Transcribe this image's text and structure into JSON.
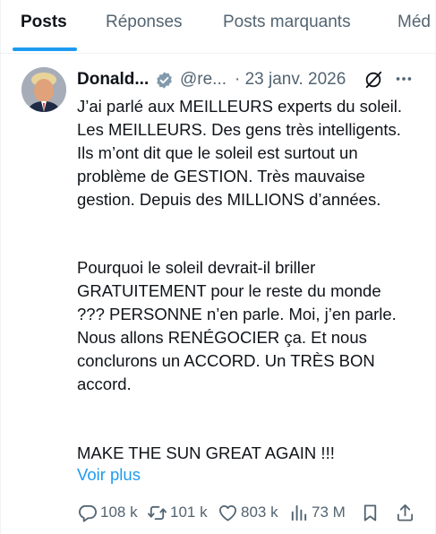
{
  "tabs": [
    {
      "label": "Posts",
      "active": true
    },
    {
      "label": "Réponses",
      "active": false
    },
    {
      "label": "Posts marquants",
      "active": false
    },
    {
      "label": "Méd",
      "active": false
    }
  ],
  "post": {
    "author_name": "Donald...",
    "handle": "@re...",
    "date": "· 23 janv. 2026",
    "paragraphs": [
      [
        "J’ai parlé aux MEILLEURS experts du soleil.",
        "Les MEILLEURS. Des gens très intelligents.",
        "Ils m’ont dit que le soleil est surtout un",
        "problème de GESTION. Très mauvaise",
        "gestion. Depuis des MILLIONS d’années."
      ],
      [
        "Pourquoi le soleil devrait-il briller",
        "GRATUITEMENT pour le reste du monde",
        "??? PERSONNE n’en parle. Moi, j’en parle.",
        "Nous allons RENÉGOCIER ça. Et nous",
        "conclurons un ACCORD. Un TRÈS BON",
        "accord."
      ],
      [
        "MAKE THE SUN GREAT AGAIN !!!"
      ]
    ],
    "see_more": "Voir plus",
    "actions": {
      "replies": "108 k",
      "reposts": "101 k",
      "likes": "803 k",
      "views": "73 M"
    }
  },
  "colors": {
    "accent": "#1d9bf0",
    "text_primary": "#0f1419",
    "text_secondary": "#536471",
    "divider": "#eff3f4"
  },
  "icons": [
    "verified-badge-icon",
    "grok-icon",
    "more-icon",
    "reply-icon",
    "repost-icon",
    "like-icon",
    "views-icon",
    "bookmark-icon",
    "share-icon"
  ]
}
